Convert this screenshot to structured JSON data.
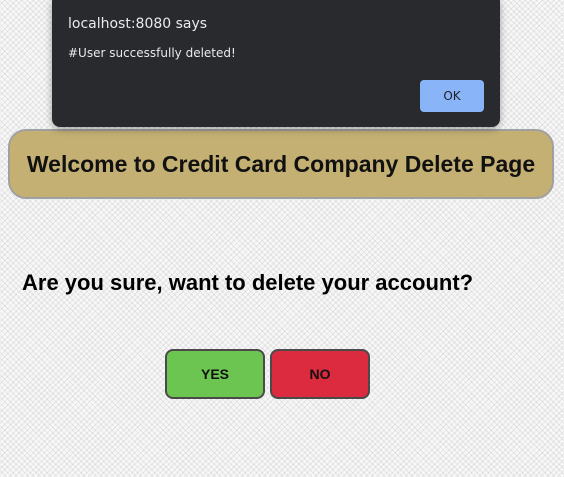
{
  "alert": {
    "title": "localhost:8080 says",
    "message": "#User successfully deleted!",
    "ok_label": "OK"
  },
  "page": {
    "banner_title": "Welcome to Credit Card Company Delete Page",
    "question": "Are you sure, want to delete your account?",
    "yes_label": "YES",
    "no_label": "NO"
  },
  "colors": {
    "banner": "#c4b073",
    "yes_button": "#6cc551",
    "no_button": "#dc2a3e",
    "dialog_background": "#292a2d",
    "dialog_ok_button": "#8ab4f8"
  }
}
